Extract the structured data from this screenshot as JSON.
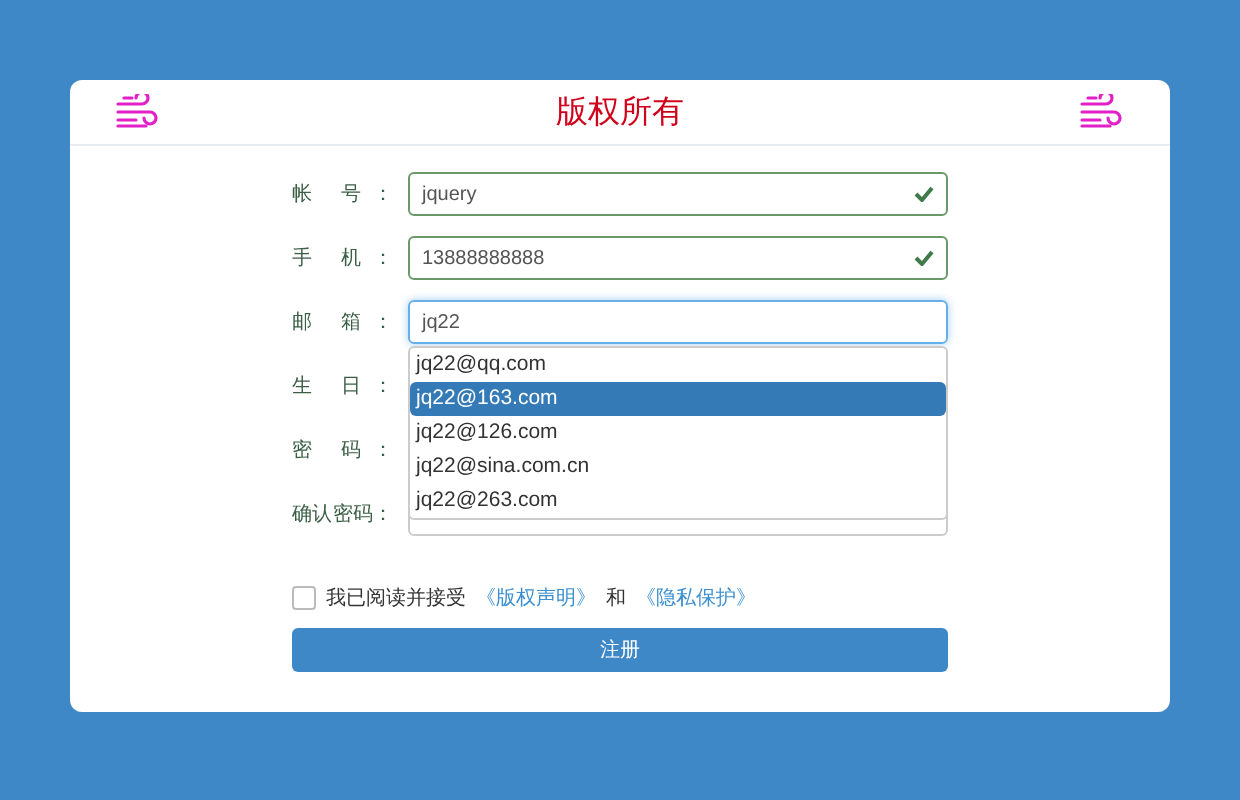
{
  "header": {
    "title": "版权所有"
  },
  "fields": [
    {
      "label": "帐 号：",
      "value": "jquery",
      "valid": true,
      "focused": false
    },
    {
      "label": "手 机：",
      "value": "13888888888",
      "valid": true,
      "focused": false
    },
    {
      "label": "邮 箱：",
      "value": "jq22",
      "valid": false,
      "focused": true
    },
    {
      "label": "生 日："
    },
    {
      "label": "密 码："
    },
    {
      "label": "确认密码："
    }
  ],
  "suggestions": [
    {
      "text": "jq22@qq.com",
      "selected": false
    },
    {
      "text": "jq22@163.com",
      "selected": true
    },
    {
      "text": "jq22@126.com",
      "selected": false
    },
    {
      "text": "jq22@sina.com.cn",
      "selected": false
    },
    {
      "text": "jq22@263.com",
      "selected": false
    }
  ],
  "agreement": {
    "checked": false,
    "prefix": "我已阅读并接受",
    "link_1": "《版权声明》",
    "joiner": "和",
    "link_2": "《隐私保护》"
  },
  "submit": "注册"
}
